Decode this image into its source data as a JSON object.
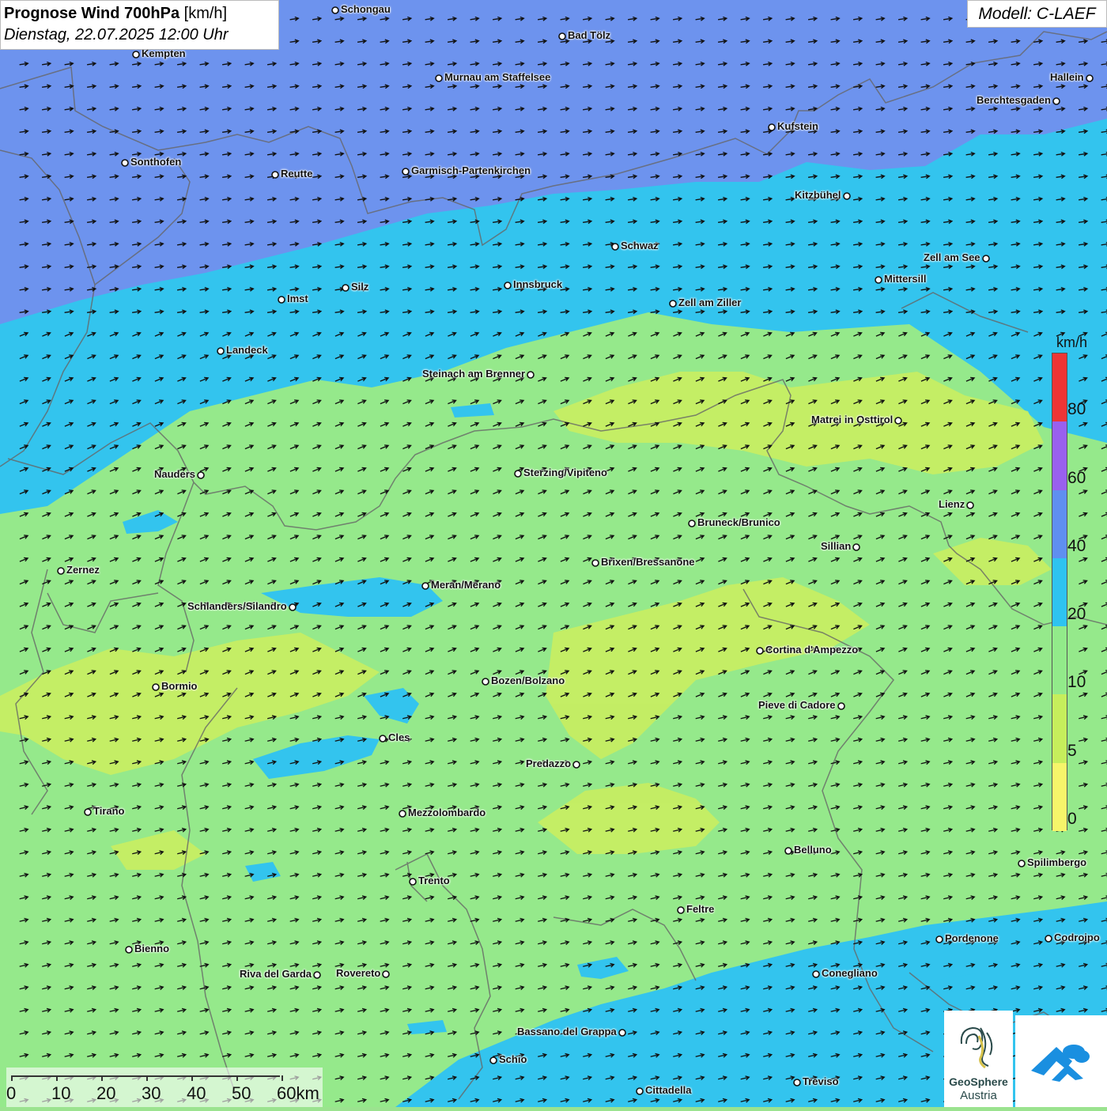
{
  "title": {
    "bold": "Prognose Wind 700hPa",
    "unit": " [km/h]",
    "date": "Dienstag, 22.07.2025 12:00 Uhr"
  },
  "model_label": "Modell: C-LAEF",
  "legend": {
    "unit": "km/h",
    "classes": [
      {
        "from": 0,
        "to": 5,
        "color": "#f6f56a"
      },
      {
        "from": 5,
        "to": 10,
        "color": "#c6ee5c"
      },
      {
        "from": 10,
        "to": 20,
        "color": "#92ea8a"
      },
      {
        "from": 20,
        "to": 40,
        "color": "#2ec3f0"
      },
      {
        "from": 40,
        "to": 60,
        "color": "#5f8ff0"
      },
      {
        "from": 60,
        "to": 80,
        "color": "#9960ee"
      },
      {
        "from": 80,
        "to": 100,
        "color": "#ee3535"
      }
    ],
    "labels": [
      "0",
      "5",
      "10",
      "20",
      "40",
      "60",
      "80"
    ]
  },
  "scale_bar": {
    "labels": [
      "0",
      "10",
      "20",
      "30",
      "40",
      "50",
      "60km"
    ]
  },
  "cities": [
    {
      "name": "Schongau"
    },
    {
      "name": "Bad Tölz"
    },
    {
      "name": "Kempten"
    },
    {
      "name": "Murnau am Staffelsee"
    },
    {
      "name": "Hallein"
    },
    {
      "name": "Berchtesgaden"
    },
    {
      "name": "Kufstein"
    },
    {
      "name": "Sonthofen"
    },
    {
      "name": "Reutte"
    },
    {
      "name": "Garmisch-Partenkirchen"
    },
    {
      "name": "Kitzbühel"
    },
    {
      "name": "Schwaz"
    },
    {
      "name": "Zell am See"
    },
    {
      "name": "Mittersill"
    },
    {
      "name": "Innsbruck"
    },
    {
      "name": "Silz"
    },
    {
      "name": "Imst"
    },
    {
      "name": "Zell am Ziller"
    },
    {
      "name": "Landeck"
    },
    {
      "name": "Steinach am Brenner"
    },
    {
      "name": "Matrei in Osttirol"
    },
    {
      "name": "Nauders"
    },
    {
      "name": "Sterzing/Vipiteno"
    },
    {
      "name": "Lienz"
    },
    {
      "name": "Bruneck/Brunico"
    },
    {
      "name": "Sillian"
    },
    {
      "name": "Zernez"
    },
    {
      "name": "Brixen/Bressanone"
    },
    {
      "name": "Meran/Merano"
    },
    {
      "name": "Schlanders/Silandro"
    },
    {
      "name": "Cortina d'Ampezzo"
    },
    {
      "name": "Bozen/Bolzano"
    },
    {
      "name": "Bormio"
    },
    {
      "name": "Pieve di Cadore"
    },
    {
      "name": "Cles"
    },
    {
      "name": "Predazzo"
    },
    {
      "name": "Tirano"
    },
    {
      "name": "Mezzolombardo"
    },
    {
      "name": "Belluno"
    },
    {
      "name": "Spilimbergo"
    },
    {
      "name": "Trento"
    },
    {
      "name": "Feltre"
    },
    {
      "name": "Pordenone"
    },
    {
      "name": "Codroipo"
    },
    {
      "name": "Bienno"
    },
    {
      "name": "Riva del Garda"
    },
    {
      "name": "Rovereto"
    },
    {
      "name": "Conegliano"
    },
    {
      "name": "Bassano del Grappa"
    },
    {
      "name": "Schio"
    },
    {
      "name": "Treviso"
    },
    {
      "name": "Cittadella"
    }
  ],
  "logos": {
    "geosphere_line1": "GeoSphere",
    "geosphere_line2": "Austria"
  }
}
